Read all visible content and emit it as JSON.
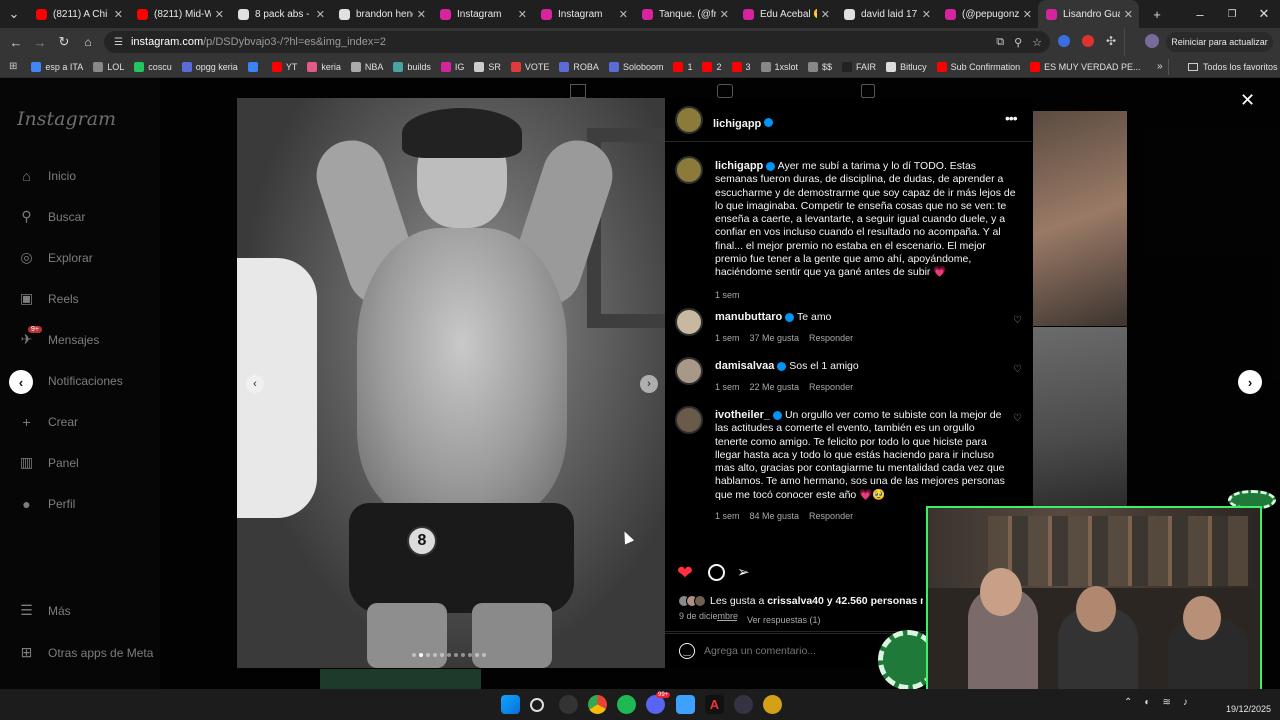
{
  "browser": {
    "tabs": [
      {
        "title": "(8211) A Chi - I",
        "color": "#ff0000"
      },
      {
        "title": "(8211) Mid-We",
        "color": "#ff0000"
      },
      {
        "title": "8 pack abs - Bu",
        "color": "#e0e0e0"
      },
      {
        "title": "brandon hend",
        "color": "#e0e0e0"
      },
      {
        "title": "Instagram",
        "color": "#d6249f"
      },
      {
        "title": "Instagram",
        "color": "#d6249f"
      },
      {
        "title": "Tanque. (@fran",
        "color": "#d6249f"
      },
      {
        "title": "Edu Acebal 😬",
        "color": "#d6249f"
      },
      {
        "title": "david laid 17 y",
        "color": "#e0e0e0"
      },
      {
        "title": "(@pepugonzal",
        "color": "#d6249f"
      },
      {
        "title": "Lisandro Guar",
        "color": "#d6249f"
      }
    ],
    "url_host": "instagram.com",
    "url_path": "/p/DSDybvajo3-/?hl=es&img_index=2",
    "update_label": "Reiniciar para actualizar",
    "bookmarks": [
      {
        "label": "esp a ITA",
        "color": "#4285f4"
      },
      {
        "label": "LOL",
        "color": "#888"
      },
      {
        "label": "coscu",
        "color": "#22c55e"
      },
      {
        "label": "opgg keria",
        "color": "#5b6bd8"
      },
      {
        "label": "",
        "color": "#3b82f6"
      },
      {
        "label": "YT",
        "color": "#ff0000"
      },
      {
        "label": "keria",
        "color": "#e05a8a"
      },
      {
        "label": "NBA",
        "color": "#aaa"
      },
      {
        "label": "builds",
        "color": "#4aa3a3"
      },
      {
        "label": "IG",
        "color": "#d6249f"
      },
      {
        "label": "SR",
        "color": "#ccc"
      },
      {
        "label": "VOTE",
        "color": "#e03a3a"
      },
      {
        "label": "ROBA",
        "color": "#5b6bd8"
      },
      {
        "label": "Soloboom",
        "color": "#5b6bd8"
      },
      {
        "label": "1",
        "color": "#ff0000"
      },
      {
        "label": "2",
        "color": "#ff0000"
      },
      {
        "label": "3",
        "color": "#ff0000"
      },
      {
        "label": "1xslot",
        "color": "#888"
      },
      {
        "label": "$$",
        "color": "#888"
      },
      {
        "label": "FAIR",
        "color": "#222"
      },
      {
        "label": "Bitlucy",
        "color": "#ddd"
      },
      {
        "label": "Sub Confirmation",
        "color": "#ff0000"
      },
      {
        "label": "ES MUY VERDAD PE...",
        "color": "#ff0000"
      }
    ],
    "favorites_label": "Todos los favoritos"
  },
  "instagram": {
    "logo": "Instagram",
    "nav": [
      {
        "label": "Inicio",
        "icon": "home-icon"
      },
      {
        "label": "Buscar",
        "icon": "search-icon"
      },
      {
        "label": "Explorar",
        "icon": "compass-icon"
      },
      {
        "label": "Reels",
        "icon": "reels-icon"
      },
      {
        "label": "Mensajes",
        "icon": "messages-icon"
      },
      {
        "label": "Notificaciones",
        "icon": "heart-icon"
      },
      {
        "label": "Crear",
        "icon": "plus-icon"
      },
      {
        "label": "Panel",
        "icon": "chart-icon"
      },
      {
        "label": "Perfil",
        "icon": "profile-icon"
      }
    ],
    "messages_badge": "9+",
    "more_label": "Más",
    "meta_label": "Otras apps de Meta"
  },
  "post": {
    "author": "lichigapp",
    "caption_author": "lichigapp",
    "caption": "Ayer me subí a tarima y lo dí TODO. Estas semanas fueron duras, de disciplina, de dudas, de aprender a escucharme y de demostrarme que soy capaz de ir más lejos de lo que imaginaba. Competir te enseña cosas que no se ven: te enseña a caerte, a levantarte, a seguir igual cuando duele, y a confiar en vos incluso cuando el resultado no acompaña. Y al final... el mejor premio no estaba en el escenario. El mejor premio fue tener a la gente que amo ahí, apoyándome, haciéndome sentir que ya gané antes de subir 💗",
    "caption_time": "1 sem",
    "comments": [
      {
        "author": "manubuttaro",
        "text": "Te amo",
        "time": "1 sem",
        "likes": "37 Me gusta",
        "reply": "Responder"
      },
      {
        "author": "damisalvaa",
        "text": "Sos el 1 amigo",
        "time": "1 sem",
        "likes": "22 Me gusta",
        "reply": "Responder"
      },
      {
        "author": "ivotheiler_",
        "text": "Un orgullo ver como te subiste con la mejor de las actitudes a comerte el evento, también es un orgullo tenerte como amigo. Te felicito por todo lo que hiciste para llegar hasta aca y todo lo que estás haciendo para ir incluso mas alto, gracias por contagiarme tu mentalidad cada vez que hablamos. Te amo hermano, sos una de las mejores personas que me tocó conocer este año 💗🥹",
        "time": "1 sem",
        "likes": "84 Me gusta",
        "reply": "Responder"
      }
    ],
    "view_replies": "Ver respuestas (1)",
    "likes_text_prefix": "Les gusta a ",
    "likes_user": "crissalva40",
    "likes_text_suffix": " y 42.560 personas m",
    "date": "9 de diciembre",
    "comment_placeholder": "Agrega un comentario...",
    "photo_number": "8"
  },
  "taskbar": {
    "date": "19/12/2025",
    "badge": "99+"
  },
  "colors": {
    "like_red": "#ff3040",
    "verified_blue": "#0095f6",
    "webcam_border": "#3cf06a"
  }
}
